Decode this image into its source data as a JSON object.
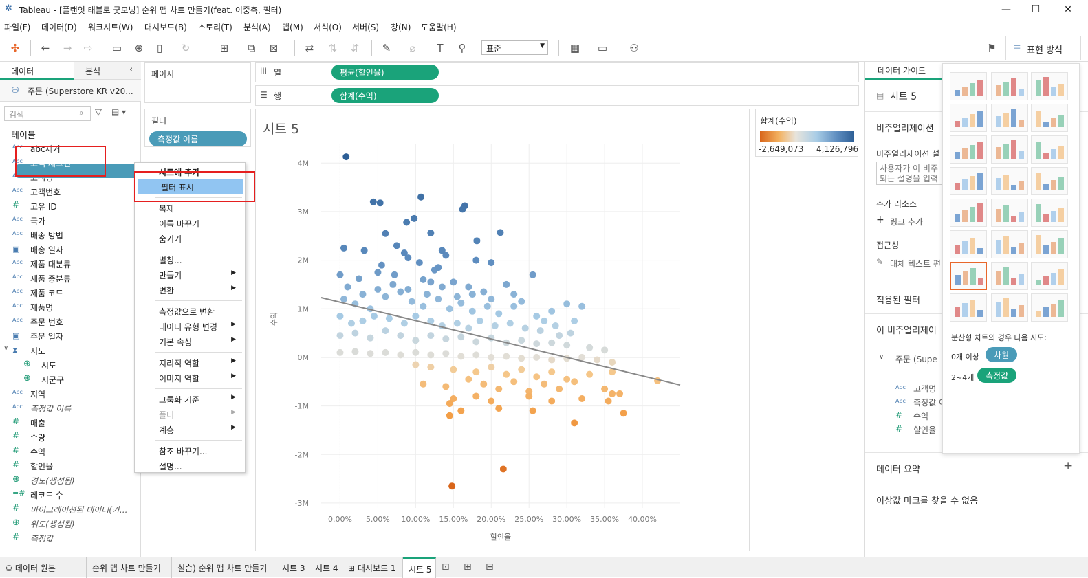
{
  "window": {
    "title": "Tableau - [플랜잇 태블로 굿모닝] 순위 맵 차트 만들기(feat. 이중축, 필터)"
  },
  "menu": [
    "파일(F)",
    "데이터(D)",
    "워크시트(W)",
    "대시보드(B)",
    "스토리(T)",
    "분석(A)",
    "맵(M)",
    "서식(O)",
    "서버(S)",
    "창(N)",
    "도움말(H)"
  ],
  "toolbar": {
    "fit": "표준",
    "format": "표현 방식"
  },
  "left": {
    "tab_data": "데이터",
    "tab_analysis": "분석",
    "datasource": "주문 (Superstore KR v20...",
    "search_placeholder": "검색",
    "tables_header": "테이블",
    "fields": [
      {
        "icon": "Abc",
        "label": "abc제거",
        "italic": false
      },
      {
        "icon": "Abc",
        "label": "고객 세그먼트",
        "italic": false
      },
      {
        "icon": "Abc",
        "label": "고객명",
        "italic": false
      },
      {
        "icon": "Abc",
        "label": "고객번호",
        "italic": false
      },
      {
        "icon": "#",
        "label": "고유 ID",
        "italic": false
      },
      {
        "icon": "Abc",
        "label": "국가",
        "italic": false
      },
      {
        "icon": "Abc",
        "label": "배송 방법",
        "italic": false
      },
      {
        "icon": "cal",
        "label": "배송 일자",
        "italic": false
      },
      {
        "icon": "Abc",
        "label": "제품 대분류",
        "italic": false
      },
      {
        "icon": "Abc",
        "label": "제품 중분류",
        "italic": false
      },
      {
        "icon": "Abc",
        "label": "제품 코드",
        "italic": false
      },
      {
        "icon": "Abc",
        "label": "제품명",
        "italic": false
      },
      {
        "icon": "Abc",
        "label": "주문 번호",
        "italic": false
      },
      {
        "icon": "cal",
        "label": "주문 일자",
        "italic": false
      },
      {
        "icon": "hier",
        "label": "지도",
        "italic": false
      },
      {
        "icon": "globe",
        "label": "시도",
        "italic": false
      },
      {
        "icon": "globe",
        "label": "시군구",
        "italic": false
      },
      {
        "icon": "Abc",
        "label": "지역",
        "italic": false
      },
      {
        "icon": "Abc",
        "label": "측정값 이름",
        "italic": true
      },
      {
        "icon": "#",
        "label": "매출",
        "italic": false
      },
      {
        "icon": "#",
        "label": "수량",
        "italic": false
      },
      {
        "icon": "#",
        "label": "수익",
        "italic": false
      },
      {
        "icon": "#",
        "label": "할인율",
        "italic": false
      },
      {
        "icon": "globe",
        "label": "경도(생성됨)",
        "italic": true
      },
      {
        "icon": "=#",
        "label": "레코드 수",
        "italic": false
      },
      {
        "icon": "#",
        "label": "마이그레이션된 데이터(카...",
        "italic": true
      },
      {
        "icon": "globe",
        "label": "위도(생성됨)",
        "italic": true
      },
      {
        "icon": "#",
        "label": "측정값",
        "italic": true
      }
    ]
  },
  "shelves": {
    "pages": "페이지",
    "filters": "필터",
    "filter_pill": "측정값 이름",
    "columns_label": "열",
    "rows_label": "행",
    "columns_pill": "평균(할인율)",
    "rows_pill": "합계(수익)"
  },
  "context_menu": [
    {
      "label": "시트에 추가",
      "sub": false,
      "bold": true
    },
    {
      "label": "필터 표시",
      "sub": false,
      "hl": true
    },
    {
      "sep": true
    },
    {
      "label": "복제",
      "sub": false
    },
    {
      "label": "이름 바꾸기",
      "sub": false
    },
    {
      "label": "숨기기",
      "sub": false
    },
    {
      "sep": true
    },
    {
      "label": "별칭...",
      "sub": false
    },
    {
      "label": "만들기",
      "sub": true
    },
    {
      "label": "변환",
      "sub": true
    },
    {
      "sep": true
    },
    {
      "label": "측정값으로 변환",
      "sub": false
    },
    {
      "label": "데이터 유형 변경",
      "sub": true
    },
    {
      "label": "기본 속성",
      "sub": true
    },
    {
      "sep": true
    },
    {
      "label": "지리적 역할",
      "sub": true
    },
    {
      "label": "이미지 역할",
      "sub": true
    },
    {
      "sep": true
    },
    {
      "label": "그룹화 기준",
      "sub": true
    },
    {
      "label": "폴더",
      "sub": true,
      "disabled": true
    },
    {
      "label": "계층",
      "sub": true
    },
    {
      "sep": true
    },
    {
      "label": "참조 바꾸기...",
      "sub": false
    },
    {
      "label": "설명...",
      "sub": false
    }
  ],
  "sheet": {
    "title": "시트 5"
  },
  "legend": {
    "title": "합계(수익)",
    "min": "-2,649,073",
    "max": "4,126,796"
  },
  "chart_data": {
    "type": "scatter",
    "xlabel": "할인율",
    "ylabel": "수익",
    "xlim": [
      -0.025,
      0.45
    ],
    "ylim": [
      -3.1,
      4.4
    ],
    "xticks": [
      0,
      0.05,
      0.1,
      0.15,
      0.2,
      0.25,
      0.3,
      0.35,
      0.4
    ],
    "xtick_labels": [
      "0.00%",
      "5.00%",
      "10.00%",
      "15.00%",
      "20.00%",
      "25.00%",
      "30.00%",
      "35.00%",
      "40.00%"
    ],
    "yticks": [
      4,
      3,
      2,
      1,
      0,
      -1,
      -2,
      -3
    ],
    "ytick_labels": [
      "4M",
      "3M",
      "2M",
      "1M",
      "0M",
      "-1M",
      "-2M",
      "-3M"
    ],
    "trend": {
      "x": [
        -0.025,
        0.45
      ],
      "y": [
        1.23,
        -0.57
      ]
    },
    "color_range": [
      -2.649073,
      4.126796
    ],
    "points": [
      [
        0.008,
        4.13
      ],
      [
        0.044,
        3.2
      ],
      [
        0.053,
        3.18
      ],
      [
        0.107,
        3.3
      ],
      [
        0.165,
        3.12
      ],
      [
        0.162,
        3.05
      ],
      [
        0.212,
        2.57
      ],
      [
        0.098,
        2.86
      ],
      [
        0.088,
        2.78
      ],
      [
        0.12,
        2.56
      ],
      [
        0.06,
        2.55
      ],
      [
        0.181,
        2.4
      ],
      [
        0.005,
        2.25
      ],
      [
        0.032,
        2.2
      ],
      [
        0.085,
        2.15
      ],
      [
        0.14,
        2.1
      ],
      [
        0.18,
        2.0
      ],
      [
        0.2,
        1.95
      ],
      [
        0.255,
        1.7
      ],
      [
        0.0,
        1.7
      ],
      [
        0.025,
        1.62
      ],
      [
        0.055,
        1.9
      ],
      [
        0.072,
        1.7
      ],
      [
        0.11,
        1.6
      ],
      [
        0.125,
        1.8
      ],
      [
        0.15,
        1.55
      ],
      [
        0.17,
        1.45
      ],
      [
        0.19,
        1.35
      ],
      [
        0.22,
        1.5
      ],
      [
        0.23,
        1.3
      ],
      [
        0.005,
        1.2
      ],
      [
        0.02,
        1.1
      ],
      [
        0.04,
        1.0
      ],
      [
        0.06,
        1.25
      ],
      [
        0.08,
        1.35
      ],
      [
        0.095,
        1.15
      ],
      [
        0.11,
        1.05
      ],
      [
        0.13,
        1.2
      ],
      [
        0.145,
        1.0
      ],
      [
        0.16,
        1.12
      ],
      [
        0.175,
        0.95
      ],
      [
        0.195,
        1.05
      ],
      [
        0.21,
        0.9
      ],
      [
        0.24,
        1.15
      ],
      [
        0.26,
        0.85
      ],
      [
        0.28,
        0.95
      ],
      [
        0.3,
        1.1
      ],
      [
        0.32,
        1.05
      ],
      [
        0.0,
        0.85
      ],
      [
        0.015,
        0.7
      ],
      [
        0.03,
        0.75
      ],
      [
        0.045,
        0.85
      ],
      [
        0.065,
        0.8
      ],
      [
        0.085,
        0.7
      ],
      [
        0.1,
        0.85
      ],
      [
        0.12,
        0.75
      ],
      [
        0.135,
        0.65
      ],
      [
        0.155,
        0.7
      ],
      [
        0.17,
        0.6
      ],
      [
        0.185,
        0.75
      ],
      [
        0.205,
        0.65
      ],
      [
        0.225,
        0.7
      ],
      [
        0.245,
        0.6
      ],
      [
        0.265,
        0.55
      ],
      [
        0.285,
        0.65
      ],
      [
        0.305,
        0.5
      ],
      [
        0.0,
        0.45
      ],
      [
        0.02,
        0.5
      ],
      [
        0.04,
        0.4
      ],
      [
        0.06,
        0.55
      ],
      [
        0.08,
        0.45
      ],
      [
        0.1,
        0.35
      ],
      [
        0.12,
        0.45
      ],
      [
        0.14,
        0.38
      ],
      [
        0.16,
        0.42
      ],
      [
        0.18,
        0.32
      ],
      [
        0.2,
        0.4
      ],
      [
        0.22,
        0.3
      ],
      [
        0.24,
        0.35
      ],
      [
        0.26,
        0.28
      ],
      [
        0.28,
        0.3
      ],
      [
        0.3,
        0.25
      ],
      [
        0.33,
        0.2
      ],
      [
        0.35,
        0.15
      ],
      [
        0.0,
        0.1
      ],
      [
        0.02,
        0.12
      ],
      [
        0.04,
        0.08
      ],
      [
        0.06,
        0.1
      ],
      [
        0.08,
        0.05
      ],
      [
        0.1,
        0.1
      ],
      [
        0.12,
        0.05
      ],
      [
        0.14,
        0.08
      ],
      [
        0.16,
        0.02
      ],
      [
        0.18,
        0.05
      ],
      [
        0.2,
        0.0
      ],
      [
        0.22,
        0.02
      ],
      [
        0.24,
        -0.02
      ],
      [
        0.26,
        0.0
      ],
      [
        0.28,
        -0.05
      ],
      [
        0.3,
        -0.02
      ],
      [
        0.32,
        0.0
      ],
      [
        0.34,
        -0.05
      ],
      [
        0.36,
        -0.1
      ],
      [
        0.1,
        -0.15
      ],
      [
        0.12,
        -0.2
      ],
      [
        0.15,
        -0.25
      ],
      [
        0.18,
        -0.3
      ],
      [
        0.2,
        -0.2
      ],
      [
        0.22,
        -0.35
      ],
      [
        0.24,
        -0.25
      ],
      [
        0.26,
        -0.4
      ],
      [
        0.28,
        -0.3
      ],
      [
        0.3,
        -0.45
      ],
      [
        0.33,
        -0.35
      ],
      [
        0.36,
        -0.3
      ],
      [
        0.11,
        -0.55
      ],
      [
        0.14,
        -0.6
      ],
      [
        0.17,
        -0.45
      ],
      [
        0.19,
        -0.55
      ],
      [
        0.21,
        -0.65
      ],
      [
        0.23,
        -0.5
      ],
      [
        0.25,
        -0.7
      ],
      [
        0.27,
        -0.55
      ],
      [
        0.29,
        -0.65
      ],
      [
        0.31,
        -0.5
      ],
      [
        0.35,
        -0.65
      ],
      [
        0.37,
        -0.75
      ],
      [
        0.15,
        -0.85
      ],
      [
        0.18,
        -0.8
      ],
      [
        0.2,
        -0.9
      ],
      [
        0.25,
        -0.8
      ],
      [
        0.28,
        -0.9
      ],
      [
        0.32,
        -0.85
      ],
      [
        0.355,
        -0.9
      ],
      [
        0.145,
        -0.95
      ],
      [
        0.16,
        -1.1
      ],
      [
        0.145,
        -1.2
      ],
      [
        0.21,
        -1.05
      ],
      [
        0.255,
        -1.1
      ],
      [
        0.36,
        -0.75
      ],
      [
        0.375,
        -1.15
      ],
      [
        0.31,
        -1.35
      ],
      [
        0.216,
        -2.3
      ],
      [
        0.148,
        -2.65
      ],
      [
        0.42,
        -0.48
      ],
      [
        0.01,
        1.45
      ],
      [
        0.03,
        1.3
      ],
      [
        0.05,
        1.4
      ],
      [
        0.07,
        1.5
      ],
      [
        0.09,
        1.4
      ],
      [
        0.115,
        1.3
      ],
      [
        0.135,
        1.45
      ],
      [
        0.155,
        1.25
      ],
      [
        0.175,
        1.3
      ],
      [
        0.2,
        1.2
      ],
      [
        0.12,
        1.55
      ],
      [
        0.09,
        2.05
      ],
      [
        0.105,
        1.95
      ],
      [
        0.13,
        1.85
      ],
      [
        0.075,
        2.3
      ],
      [
        0.05,
        1.75
      ],
      [
        0.135,
        2.2
      ],
      [
        0.23,
        1.05
      ],
      [
        0.27,
        0.75
      ],
      [
        0.29,
        0.45
      ],
      [
        0.31,
        0.75
      ]
    ]
  },
  "right": {
    "tab": "데이터 가이드",
    "sheet": "시트 5",
    "viz_header": "비주얼리제이션",
    "viz_desc_label": "비주얼리제이션 설",
    "viz_desc_placeholder": "사용자가 이 비주\n되는 설명을 입력",
    "more_resources": "추가 리소스",
    "add_link": "링크 추가",
    "accessibility": "접근성",
    "alt_text": "대체 텍스트 편",
    "applied_filters": "적용된 필터",
    "this_viz": "이 비주얼리제이",
    "source": "주문 (Supe",
    "source_fields": [
      {
        "icon": "Abc",
        "label": "고객명"
      },
      {
        "icon": "Abc",
        "label": "측정값 이"
      },
      {
        "icon": "#",
        "label": "수익"
      },
      {
        "icon": "#",
        "label": "할인율"
      }
    ],
    "data_summary": "데이터 요약",
    "no_outliers": "이상값 마크를 찾을 수 없음"
  },
  "showme": {
    "hint": "분산형 차트의 경우 다음 시도:",
    "dims_label": "0개 이상",
    "dims_pill": "차원",
    "meas_label": "2~4개",
    "meas_pill": "측정값"
  },
  "bottom_tabs": [
    "데이터 원본",
    "순위 맵 차트 만들기",
    "실습) 순위 맵 차트 만들기",
    "시트 3",
    "시트 4",
    "대시보드 1",
    "시트 5"
  ]
}
